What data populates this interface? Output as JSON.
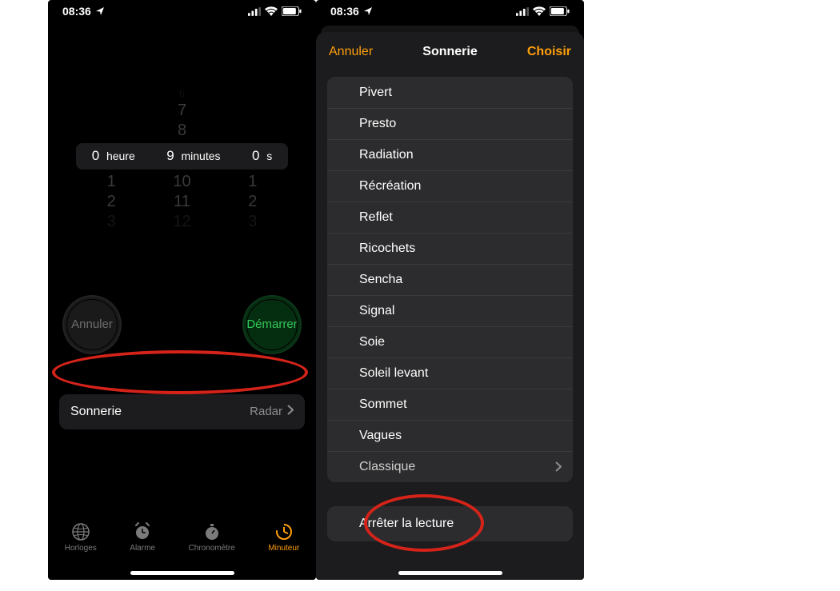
{
  "status": {
    "time": "08:36"
  },
  "timer": {
    "picker_above_faint": "6",
    "picker_above": [
      "7",
      "8"
    ],
    "hours": "0",
    "hours_unit": "heure",
    "minutes": "9",
    "minutes_unit": "minutes",
    "seconds": "0",
    "seconds_unit": "s",
    "below1": [
      "1",
      "10",
      "1"
    ],
    "below2": [
      "2",
      "11",
      "2"
    ],
    "below3": [
      "3",
      "12",
      "3"
    ],
    "cancel": "Annuler",
    "start": "Démarrer",
    "sonnerie_label": "Sonnerie",
    "sonnerie_value": "Radar"
  },
  "tabs": {
    "clocks": "Horloges",
    "alarm": "Alarme",
    "stopwatch": "Chronomètre",
    "timer": "Minuteur"
  },
  "sheet": {
    "cancel": "Annuler",
    "title": "Sonnerie",
    "choose": "Choisir",
    "items": [
      "Pivert",
      "Presto",
      "Radiation",
      "Récréation",
      "Reflet",
      "Ricochets",
      "Sencha",
      "Signal",
      "Soie",
      "Soleil levant",
      "Sommet",
      "Vagues",
      "Classique"
    ],
    "stop": "Arrêter la lecture"
  }
}
